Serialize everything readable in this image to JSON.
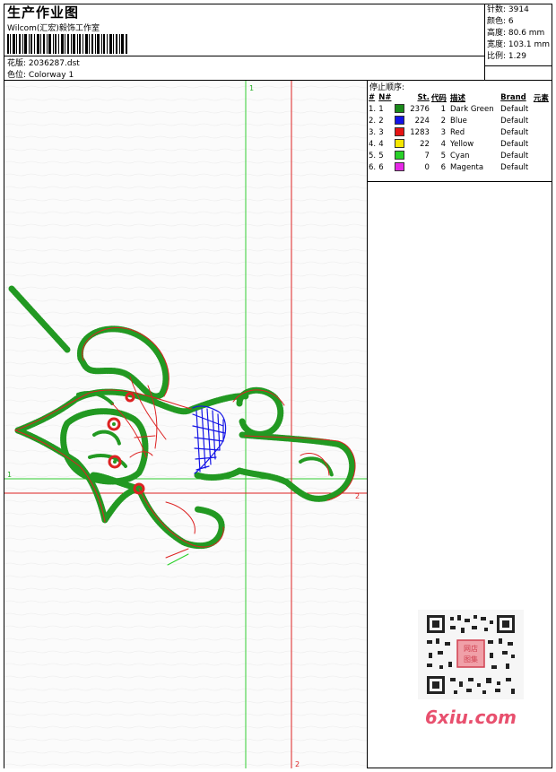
{
  "header": {
    "title": "生产作业图",
    "company": "Wilcom(汇宏)毅饰工作室",
    "design_label": "花版:",
    "design_value": "2036287.dst",
    "colorway_label": "色位:",
    "colorway_value": "Colorway 1"
  },
  "stats": {
    "stitches": "针数: 3914",
    "colors": "颜色: 6",
    "height": "高度: 80.6 mm",
    "width": "宽度: 103.1 mm",
    "scale": "比例: 1.29"
  },
  "stop_sequence": {
    "title": "停止顺序:",
    "headers": [
      "#",
      "N#",
      "",
      "St.",
      "代码",
      "描述",
      "Brand",
      "元素"
    ],
    "rows": [
      {
        "idx": "1.",
        "n": "1",
        "color": "#1a8a1a",
        "st": "2376",
        "code": "1",
        "desc": "Dark Green",
        "brand": "Default"
      },
      {
        "idx": "2.",
        "n": "2",
        "color": "#1414e6",
        "st": "224",
        "code": "2",
        "desc": "Blue",
        "brand": "Default"
      },
      {
        "idx": "3.",
        "n": "3",
        "color": "#e61414",
        "st": "1283",
        "code": "3",
        "desc": "Red",
        "brand": "Default"
      },
      {
        "idx": "4.",
        "n": "4",
        "color": "#f5e600",
        "st": "22",
        "code": "4",
        "desc": "Yellow",
        "brand": "Default"
      },
      {
        "idx": "5.",
        "n": "5",
        "color": "#28d028",
        "st": "7",
        "code": "5",
        "desc": "Cyan",
        "brand": "Default"
      },
      {
        "idx": "6.",
        "n": "6",
        "color": "#e628e6",
        "st": "0",
        "code": "6",
        "desc": "Magenta",
        "brand": "Default"
      }
    ]
  },
  "axis_labels": {
    "green_top": "1",
    "green_left": "1",
    "red_right": "2",
    "red_bottom": "2"
  },
  "watermark": {
    "logo": "6xiu.com",
    "seal": "网店图集"
  }
}
